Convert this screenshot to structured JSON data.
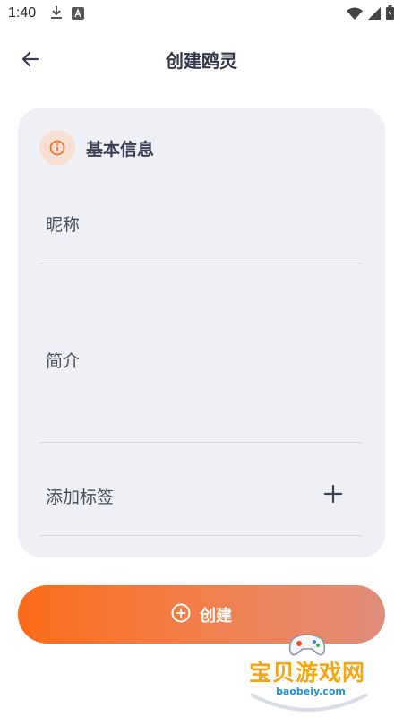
{
  "status_bar": {
    "time": "1:40"
  },
  "header": {
    "title": "创建鸥灵",
    "back_icon": "arrow-left-icon"
  },
  "card": {
    "title": "基本信息",
    "icon": "info-icon",
    "fields": {
      "nickname": "昵称",
      "intro": "简介",
      "tags": "添加标签"
    },
    "add_icon": "plus-icon"
  },
  "create_button": {
    "label": "创建",
    "icon": "plus-circle-icon"
  },
  "watermark": {
    "text": "宝贝游戏网",
    "url": "baobeiy.com"
  },
  "colors": {
    "accent": "#fb6b18",
    "card_bg": "#eff0f5",
    "title": "#33374a"
  }
}
